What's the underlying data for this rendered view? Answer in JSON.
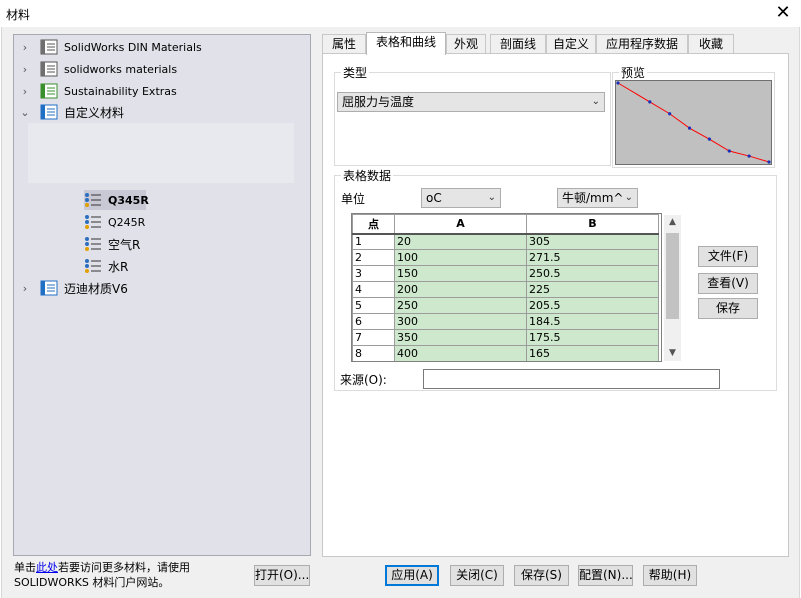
{
  "window": {
    "title": "材料",
    "close_glyph": "✕"
  },
  "tree": {
    "libraries": [
      {
        "label": "SolidWorks DIN Materials",
        "chevron": "›",
        "color": "#1f6fc5"
      },
      {
        "label": "solidworks materials",
        "chevron": "›",
        "color": "#555555"
      },
      {
        "label": "Sustainability Extras",
        "chevron": "›",
        "color": "#3a8f2d"
      },
      {
        "label": "自定义材料",
        "chevron": "⌄",
        "color": "#1f6fc5"
      },
      {
        "label": "迈迪材质V6",
        "chevron": "›",
        "color": "#1f6fc5"
      }
    ],
    "materials": [
      {
        "label": "Q345R"
      },
      {
        "label": "Q245R"
      },
      {
        "label": "空气R"
      },
      {
        "label": "水R"
      }
    ]
  },
  "hint": {
    "prefix": "单击",
    "link": "此处",
    "suffix": "若要访问更多材料，请使用",
    "line2": "SOLIDWORKS 材料门户网站。"
  },
  "buttons": {
    "open": "打开(O)...",
    "apply": "应用(A)",
    "close": "关闭(C)",
    "save": "保存(S)",
    "config": "配置(N)...",
    "help": "帮助(H)"
  },
  "tabs": [
    "属性",
    "表格和曲线",
    "外观",
    "剖面线",
    "自定义",
    "应用程序数据",
    "收藏"
  ],
  "type_group": {
    "title": "类型",
    "selected": "屈服力与温度"
  },
  "preview": {
    "title": "预览"
  },
  "table_group": {
    "title": "表格数据",
    "unit_label": "单位",
    "unit_x": "oC",
    "unit_y": "牛顿/mm^",
    "columns": [
      "点",
      "A",
      "B"
    ],
    "rows": [
      [
        "1",
        "20",
        "305"
      ],
      [
        "2",
        "100",
        "271.5"
      ],
      [
        "3",
        "150",
        "250.5"
      ],
      [
        "4",
        "200",
        "225"
      ],
      [
        "5",
        "250",
        "205.5"
      ],
      [
        "6",
        "300",
        "184.5"
      ],
      [
        "7",
        "350",
        "175.5"
      ],
      [
        "8",
        "400",
        "165"
      ]
    ],
    "file_button": "文件(F)",
    "view_button": "查看(V)",
    "save_button": "保存",
    "source_label": "来源(O):",
    "source_value": ""
  },
  "colors": {
    "accent": "#0078d7",
    "grid_cell": "#cde8cc",
    "curve": "#ff0000",
    "curve_points": "#1b2fb8"
  }
}
